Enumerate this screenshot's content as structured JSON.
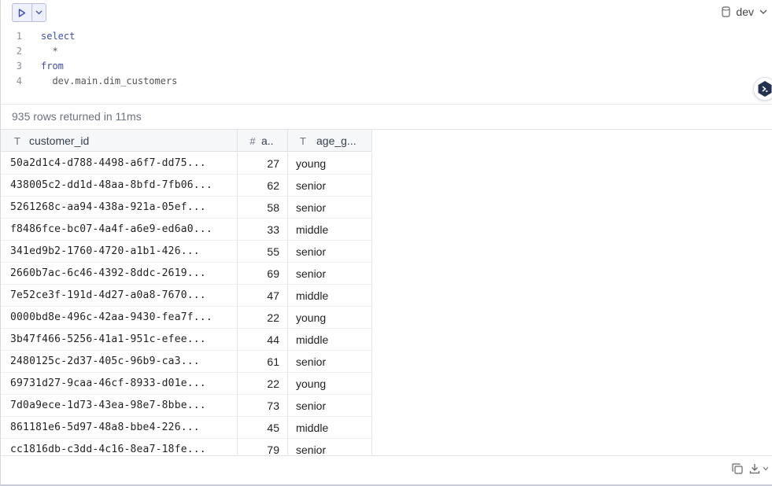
{
  "toolbar": {
    "run_icon": "play-icon",
    "menu_icon": "chevron-down-icon",
    "db_icon": "database-icon",
    "db_label": "dev"
  },
  "editor": {
    "lines": [
      {
        "no": "1",
        "code": "select",
        "keyword": true
      },
      {
        "no": "2",
        "code": "  *",
        "keyword": false
      },
      {
        "no": "3",
        "code": "from",
        "keyword": true
      },
      {
        "no": "4",
        "code": "  dev.main.dim_customers",
        "keyword": false
      }
    ]
  },
  "results": {
    "status": "935 rows returned in 11ms",
    "columns": [
      {
        "type_icon": "T",
        "label": "customer_id"
      },
      {
        "type_icon": "#",
        "label": "a.."
      },
      {
        "type_icon": "T",
        "label": "age_g..."
      }
    ],
    "rows": [
      [
        "50a2d1c4-d788-4498-a6f7-dd75...",
        "27",
        "young"
      ],
      [
        "438005c2-dd1d-48aa-8bfd-7fb06...",
        "62",
        "senior"
      ],
      [
        "5261268c-aa94-438a-921a-05ef...",
        "58",
        "senior"
      ],
      [
        "f8486fce-bc07-4a4f-a6e9-ed6a0...",
        "33",
        "middle"
      ],
      [
        "341ed9b2-1760-4720-a1b1-426...",
        "55",
        "senior"
      ],
      [
        "2660b7ac-6c46-4392-8ddc-2619...",
        "69",
        "senior"
      ],
      [
        "7e52ce3f-191d-4d27-a0a8-7670...",
        "47",
        "middle"
      ],
      [
        "0000bd8e-496c-42aa-9430-fea7f...",
        "22",
        "young"
      ],
      [
        "3b47f466-5256-41a1-951c-efee...",
        "44",
        "middle"
      ],
      [
        "2480125c-2d37-405c-96b9-ca3...",
        "61",
        "senior"
      ],
      [
        "69731d27-9caa-46cf-8933-d01e...",
        "22",
        "young"
      ],
      [
        "7d0a9ece-1d73-43ea-98e7-8bbe...",
        "73",
        "senior"
      ],
      [
        "861181e6-5d97-48a8-bbe4-226...",
        "45",
        "middle"
      ],
      [
        "cc1816db-c3dd-4c16-8ea7-18fe...",
        "79",
        "senior"
      ]
    ]
  },
  "footer": {
    "copy_icon": "copy-icon",
    "download_icon": "download-icon"
  },
  "colors": {
    "accent": "#3d4db0",
    "run_bg": "#eef0fb"
  }
}
